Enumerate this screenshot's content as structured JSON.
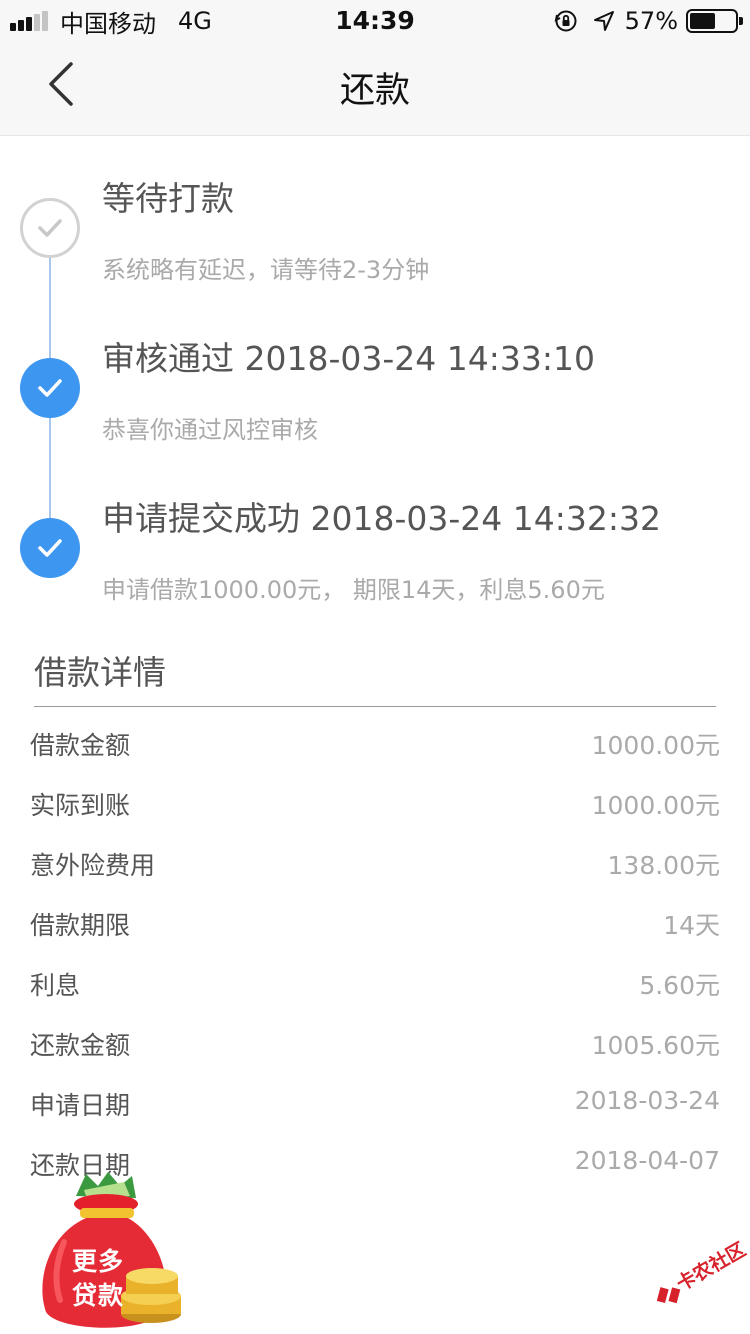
{
  "status_bar": {
    "carrier": "中国移动",
    "network": "4G",
    "time": "14:39",
    "battery_percent": "57%",
    "battery_level": 0.57,
    "icons": [
      "signal-icon",
      "orientation-lock-icon",
      "location-icon",
      "battery-icon"
    ]
  },
  "nav": {
    "back_icon": "chevron-left-icon",
    "title": "还款"
  },
  "timeline": {
    "steps": [
      {
        "title": "等待打款",
        "desc": "系统略有延迟，请等待2-3分钟",
        "status": "pending"
      },
      {
        "title": "审核通过 2018-03-24 14:33:10",
        "desc": "恭喜你通过风控审核",
        "status": "done"
      },
      {
        "title": "申请提交成功 2018-03-24 14:32:32",
        "desc": "申请借款1000.00元， 期限14天，利息5.60元",
        "status": "done"
      }
    ],
    "colors": {
      "done": "#3d96f0",
      "pending": "#d2d2d2",
      "line": "#a9c6ef"
    }
  },
  "details": {
    "title": "借款详情",
    "rows": [
      {
        "label": "借款金额",
        "value": "1000.00元"
      },
      {
        "label": "实际到账",
        "value": "1000.00元"
      },
      {
        "label": "意外险费用",
        "value": "138.00元"
      },
      {
        "label": "借款期限",
        "value": "14天"
      },
      {
        "label": "利息",
        "value": "5.60元"
      },
      {
        "label": "还款金额",
        "value": "1005.60元"
      },
      {
        "label": "申请日期",
        "value": "2018-03-24"
      },
      {
        "label": "还款日期",
        "value": "2018-04-07"
      }
    ]
  },
  "promo": {
    "line1": "更多",
    "line2": "贷款",
    "icon": "money-bag-icon"
  },
  "watermark": {
    "text": "卡农社区",
    "icon": "kanong-logo-icon"
  }
}
